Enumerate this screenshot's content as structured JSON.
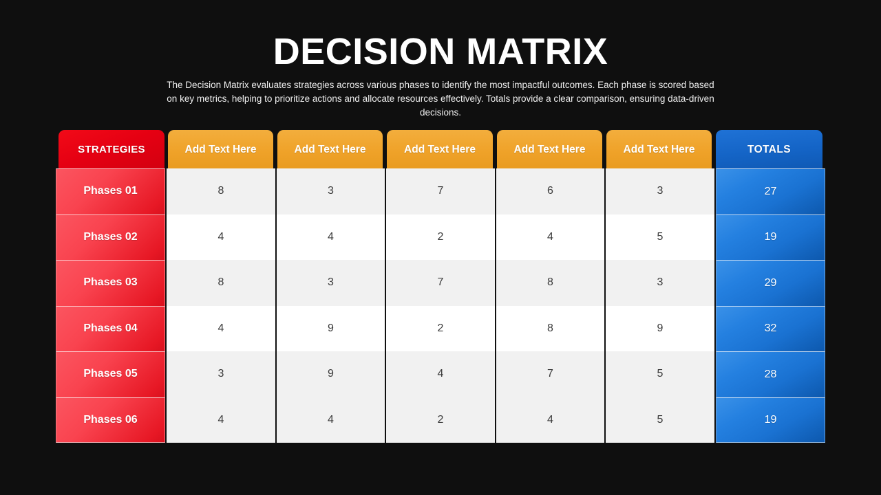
{
  "header": {
    "title": "DECISION MATRIX",
    "subtitle": "The Decision Matrix evaluates strategies across various phases to identify the most impactful outcomes. Each phase is scored based on key metrics, helping to prioritize actions and allocate resources effectively. Totals provide a clear comparison, ensuring data-driven decisions."
  },
  "colors": {
    "background": "#0f0f0f",
    "strategies_header": "#e50012",
    "column_header": "#efa229",
    "totals_header": "#1464c6",
    "phase_cell": "#f9434f",
    "total_cell": "#1a72d2",
    "row_shade": "#f1f1f1",
    "row_plain": "#ffffff",
    "text_light": "#ffffff",
    "text_dark": "#3a3a3a"
  },
  "chart_data": {
    "type": "table",
    "title": "DECISION MATRIX",
    "columns": [
      "STRATEGIES",
      "Add Text Here",
      "Add Text Here",
      "Add Text Here",
      "Add Text Here",
      "Add Text Here",
      "TOTALS"
    ],
    "rows": [
      {
        "label": "Phases 01",
        "values": [
          8,
          3,
          7,
          6,
          3
        ],
        "total": 27
      },
      {
        "label": "Phases 02",
        "values": [
          4,
          4,
          2,
          4,
          5
        ],
        "total": 19
      },
      {
        "label": "Phases 03",
        "values": [
          8,
          3,
          7,
          8,
          3
        ],
        "total": 29
      },
      {
        "label": "Phases 04",
        "values": [
          4,
          9,
          2,
          8,
          9
        ],
        "total": 32
      },
      {
        "label": "Phases 05",
        "values": [
          3,
          9,
          4,
          7,
          5
        ],
        "total": 28
      },
      {
        "label": "Phases 06",
        "values": [
          4,
          4,
          2,
          4,
          5
        ],
        "total": 19
      }
    ]
  }
}
